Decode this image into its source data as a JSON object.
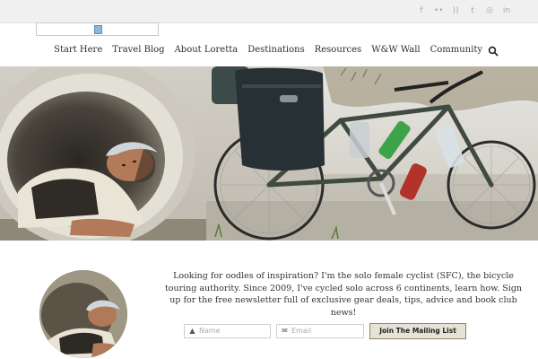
{
  "social": {
    "icons": [
      "facebook-icon",
      "flickr-icon",
      "rss-icon",
      "twitter-icon",
      "instagram-icon",
      "linkedin-icon"
    ],
    "glyphs": [
      "f",
      "••",
      "))",
      "t",
      "◎",
      "in"
    ]
  },
  "nav": {
    "items": [
      "Start Here",
      "Travel Blog",
      "About Loretta",
      "Destinations",
      "Resources",
      "W&W Wall",
      "Community"
    ]
  },
  "intro": {
    "text": "Looking for oodles of inspiration? I'm the solo female cyclist (SFC), the bicycle touring authority. Since 2009, I've cycled solo across 6 continents, learn how. Sign up for the free newsletter full of exclusive gear deals, tips, advice and book club news!"
  },
  "signup": {
    "name_placeholder": "Name",
    "email_placeholder": "Email",
    "button_label": "Join The Mailing List"
  },
  "colors": {
    "topbar": "#f0f0f0",
    "accent_border": "#8d8567"
  }
}
